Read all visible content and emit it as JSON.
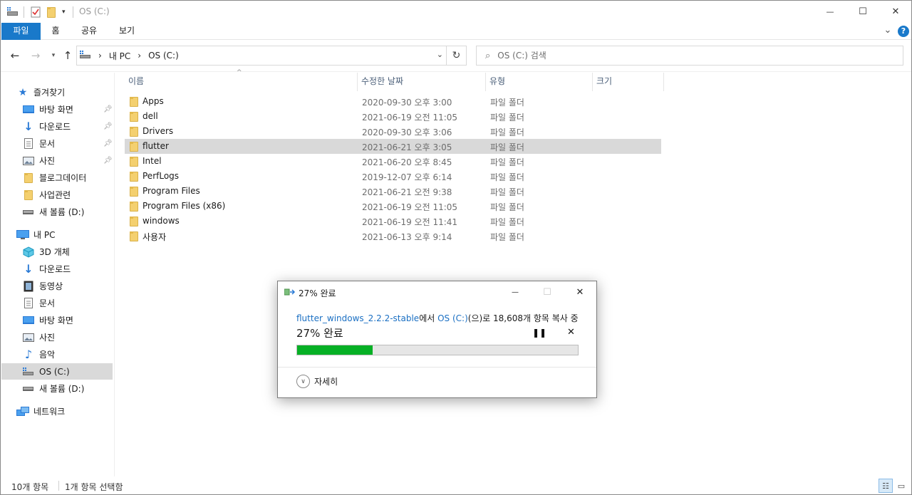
{
  "window": {
    "title": "OS (C:)",
    "minimize_glyph": "—",
    "maximize_glyph": "☐",
    "close_glyph": "✕"
  },
  "ribbon": {
    "tabs": [
      "파일",
      "홈",
      "공유",
      "보기"
    ],
    "expand_glyph": "⌄",
    "help_glyph": "?"
  },
  "address": {
    "crumbs": [
      "내 PC",
      "OS (C:)"
    ],
    "separator": "›"
  },
  "search": {
    "placeholder": "OS (C:) 검색"
  },
  "columns": {
    "name": "이름",
    "date": "수정한 날짜",
    "type": "유형",
    "size": "크기"
  },
  "files": [
    {
      "name": "Apps",
      "date": "2020-09-30 오후 3:00",
      "type": "파일 폴더"
    },
    {
      "name": "dell",
      "date": "2021-06-19 오전 11:05",
      "type": "파일 폴더"
    },
    {
      "name": "Drivers",
      "date": "2020-09-30 오후 3:06",
      "type": "파일 폴더"
    },
    {
      "name": "flutter",
      "date": "2021-06-21 오후 3:05",
      "type": "파일 폴더",
      "selected": true
    },
    {
      "name": "Intel",
      "date": "2021-06-20 오후 8:45",
      "type": "파일 폴더"
    },
    {
      "name": "PerfLogs",
      "date": "2019-12-07 오후 6:14",
      "type": "파일 폴더"
    },
    {
      "name": "Program Files",
      "date": "2021-06-21 오전 9:38",
      "type": "파일 폴더"
    },
    {
      "name": "Program Files (x86)",
      "date": "2021-06-19 오전 11:05",
      "type": "파일 폴더"
    },
    {
      "name": "windows",
      "date": "2021-06-19 오전 11:41",
      "type": "파일 폴더"
    },
    {
      "name": "사용자",
      "date": "2021-06-13 오후 9:14",
      "type": "파일 폴더"
    }
  ],
  "sidebar": {
    "quick_access": "즐겨찾기",
    "quick_items": [
      {
        "label": "바탕 화면",
        "icon": "desktop-icon",
        "pinned": true
      },
      {
        "label": "다운로드",
        "icon": "download-icon",
        "pinned": true
      },
      {
        "label": "문서",
        "icon": "document-icon",
        "pinned": true
      },
      {
        "label": "사진",
        "icon": "picture-icon",
        "pinned": true
      },
      {
        "label": "블로그데이터",
        "icon": "folder-icon",
        "pinned": false
      },
      {
        "label": "사업관련",
        "icon": "folder-icon",
        "pinned": false
      },
      {
        "label": "새 볼륨 (D:)",
        "icon": "drive-icon",
        "pinned": false
      }
    ],
    "this_pc": "내 PC",
    "pc_items": [
      {
        "label": "3D 개체",
        "icon": "3d-objects-icon"
      },
      {
        "label": "다운로드",
        "icon": "download-icon"
      },
      {
        "label": "동영상",
        "icon": "video-icon"
      },
      {
        "label": "문서",
        "icon": "document-icon"
      },
      {
        "label": "바탕 화면",
        "icon": "desktop-icon"
      },
      {
        "label": "사진",
        "icon": "picture-icon"
      },
      {
        "label": "음악",
        "icon": "music-icon"
      },
      {
        "label": "OS (C:)",
        "icon": "os-drive-icon",
        "selected": true
      },
      {
        "label": "새 볼륨 (D:)",
        "icon": "drive-icon"
      }
    ],
    "network": "네트워크"
  },
  "status": {
    "count": "10개 항목",
    "selection": "1개 항목 선택함"
  },
  "dialog": {
    "title": "27% 완료",
    "source_link": "flutter_windows_2.2.2-stable",
    "text_from": "에서 ",
    "dest_link": "OS (C:)",
    "text_rest": "(으)로 18,608개 항목 복사 중",
    "percent_label": "27% 완료",
    "progress": 0.27,
    "details_label": "자세히",
    "progress_color": "#06b025"
  },
  "colors": {
    "accent": "#1979ca",
    "link": "#1a6fc3",
    "selection": "#d9d9d9",
    "help": "#1979ca"
  }
}
